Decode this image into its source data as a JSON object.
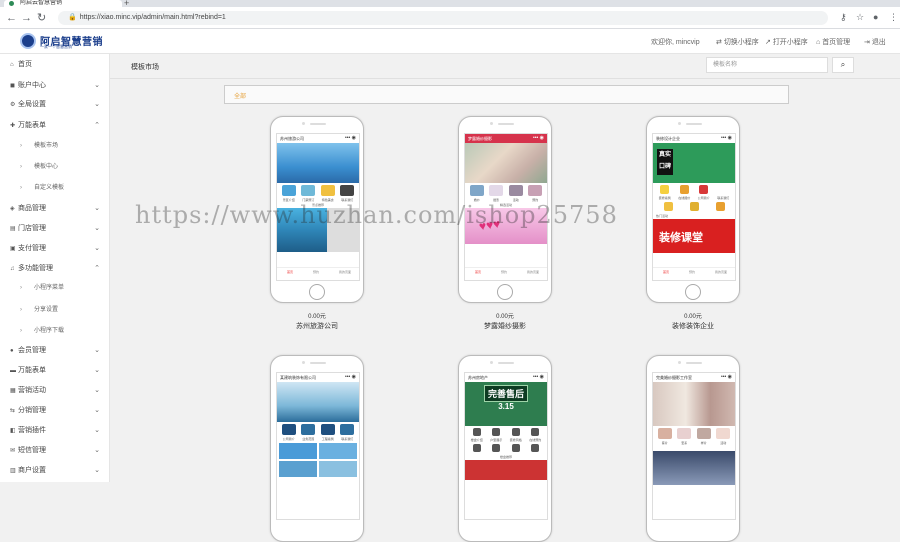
{
  "browser": {
    "tab_title": "阿启云智慧营销",
    "url": "https://xiao.minc.vip/admin/main.html?rebind=1"
  },
  "header": {
    "brand": "阿启智慧营销",
    "brand_sub": "一家一个智慧营销",
    "welcome": "欢迎你, mincvip",
    "switch": "切换小程序",
    "open": "打开小程序",
    "home": "首页管理",
    "logout": "退出"
  },
  "sidebar": {
    "items": [
      {
        "label": "首页",
        "icon": "home-icon"
      },
      {
        "label": "账户中心",
        "icon": "user-icon"
      },
      {
        "label": "全局设置",
        "icon": "gear-icon"
      },
      {
        "label": "万能表单",
        "icon": "plus-icon"
      },
      {
        "label": "模板市场"
      },
      {
        "label": "模板中心"
      },
      {
        "label": "自定义模板"
      },
      {
        "label": "商品管理",
        "icon": "cube-icon"
      },
      {
        "label": "门店管理",
        "icon": "shop-icon"
      },
      {
        "label": "支付管理",
        "icon": "wallet-icon"
      },
      {
        "label": "多功能管理",
        "icon": "music-icon"
      },
      {
        "label": "小程序菜单"
      },
      {
        "label": "分享设置"
      },
      {
        "label": "小程序下载"
      },
      {
        "label": "会员管理",
        "icon": "member-icon"
      },
      {
        "label": "万能表单",
        "icon": "form-icon"
      },
      {
        "label": "营销活动",
        "icon": "cart-icon"
      },
      {
        "label": "分销管理",
        "icon": "share-icon"
      },
      {
        "label": "营销插件",
        "icon": "plugin-icon"
      },
      {
        "label": "短信管理",
        "icon": "sms-icon"
      },
      {
        "label": "商户设置",
        "icon": "store-icon"
      }
    ]
  },
  "main": {
    "breadcrumb": "模板市场",
    "search_placeholder": "模板名称",
    "filter_label": "全部",
    "watermark": "https://www.huzhan.com/ishop25758",
    "templates": [
      {
        "title": "苏州旅游公司",
        "price": "0.00元",
        "name": "苏州旅游公司",
        "menu": [
          "景区介绍",
          "门票预订",
          "特色美食",
          "联系我们"
        ],
        "section": "景点推荐",
        "tabs": [
          "首页",
          "预约",
          "我的页面"
        ]
      },
      {
        "title": "梦露婚纱摄影",
        "price": "0.00元",
        "name": "梦露婚纱摄影",
        "menu": [
          "婚纱",
          "摄影",
          "活动",
          "预约"
        ],
        "section": "精选活动",
        "tabs": [
          "首页",
          "预约",
          "我的页面"
        ]
      },
      {
        "title": "装修设计企业",
        "price": "0.00元",
        "name": "装修装饰企业",
        "banner_text": "真实口碑",
        "promo_text": "装修课堂",
        "menu": [
          "装修案例",
          "在线报价",
          "公司简介",
          "联系我们"
        ],
        "section": "热门活动",
        "tabs": [
          "首页",
          "预约",
          "我的页面"
        ]
      },
      {
        "title": "某建筑装饰有限公司",
        "price": "",
        "name": "",
        "menu": [
          "公司简介",
          "业务范围",
          "工程案例",
          "联系我们"
        ],
        "section": "",
        "tabs": []
      },
      {
        "title": "苏州房地产",
        "price": "",
        "name": "",
        "banner_text": "完善售后",
        "banner_date": "3.15",
        "menu": [
          "楼盘介绍",
          "户型展示",
          "装修风格",
          "在线预约"
        ],
        "section": "楼盘推荐",
        "tabs": []
      },
      {
        "title": "完美婚纱摄影工作室",
        "price": "",
        "name": "",
        "menu": [
          "客片",
          "套系",
          "样片",
          "活动"
        ],
        "section": "",
        "tabs": []
      }
    ]
  }
}
